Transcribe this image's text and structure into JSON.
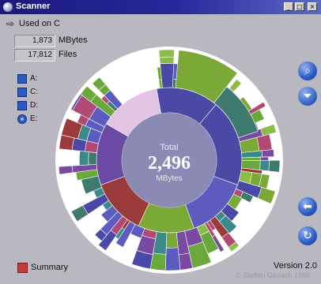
{
  "window": {
    "title": "Scanner",
    "buttons": [
      "_",
      "□",
      "×"
    ]
  },
  "location": {
    "label": "Used on C",
    "icon": "arrow-right-icon"
  },
  "stats": [
    {
      "value": "1,873",
      "unit": "MBytes"
    },
    {
      "value": "17,812",
      "unit": "Files"
    }
  ],
  "drives": [
    {
      "label": "A:",
      "icon": "floppy-drive-icon"
    },
    {
      "label": "C:",
      "icon": "hard-drive-icon"
    },
    {
      "label": "D:",
      "icon": "hard-drive-icon"
    },
    {
      "label": "E:",
      "icon": "cd-drive-icon"
    }
  ],
  "center": {
    "caption": "Total",
    "value": "2,496",
    "unit": "MBytes"
  },
  "side_buttons": [
    {
      "name": "zoom-in-button",
      "icon": "magnifier-icon",
      "color": "#2a5ac4"
    },
    {
      "name": "filter-button",
      "icon": "funnel-icon",
      "color": "#3a68c6"
    },
    {
      "name": "back-button",
      "icon": "back-arrow-icon",
      "color": "#2a5ac4"
    },
    {
      "name": "refresh-button",
      "icon": "refresh-icon",
      "color": "#2a5ac4"
    }
  ],
  "footer": {
    "summary_label": "Summary",
    "version": "Version 2.0",
    "copyright": "© Steffen Gerlach 1998"
  },
  "colors": {
    "window_bg": "#b9b7bf",
    "disc": "#ffffff",
    "center_fill": "#8a8ab4",
    "free_space": "#e3c3e3",
    "segment_palette": [
      "#7ba937",
      "#4a4aa6",
      "#3e7a6e",
      "#b04a74",
      "#6aa83c",
      "#5c5cc0",
      "#9a3a3a",
      "#3b8a8a",
      "#8cbb46",
      "#7a4aa2"
    ]
  }
}
